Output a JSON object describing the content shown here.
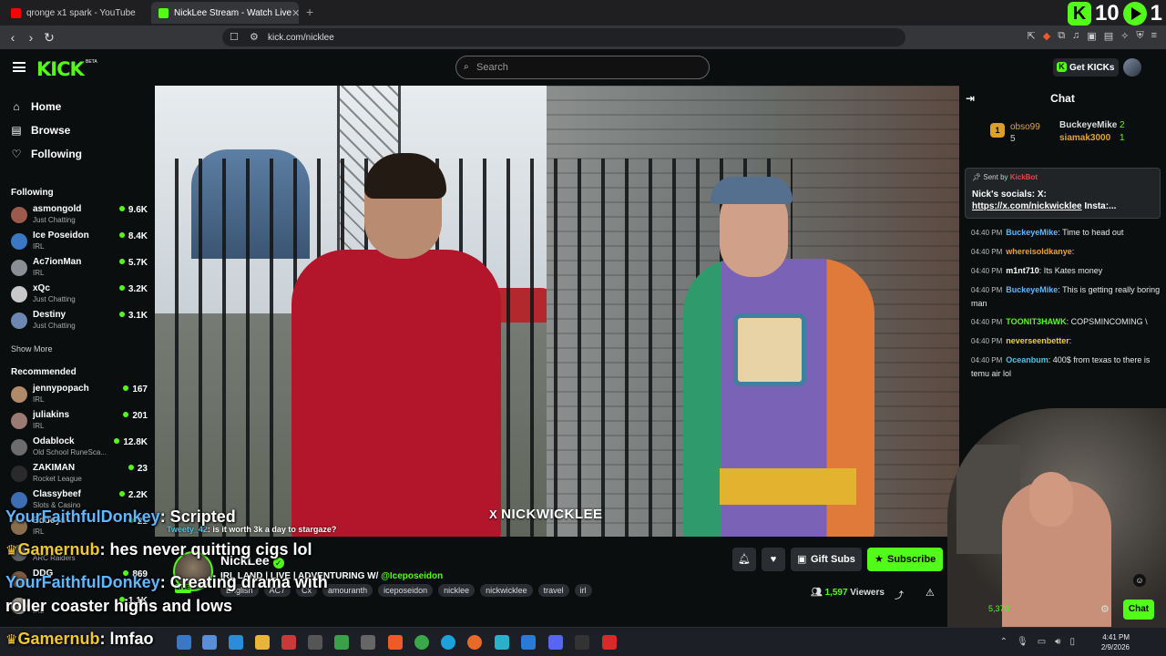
{
  "browser": {
    "tabs": [
      {
        "title": "qronge x1 spark - YouTube",
        "color": "#ff0000"
      },
      {
        "title": "NickLee Stream - Watch Live",
        "color": "#53fc18"
      }
    ],
    "new_tab": "+",
    "url": "kick.com/nicklee",
    "counter": {
      "left": "10",
      "right": "1"
    }
  },
  "header": {
    "logo": "KICK",
    "beta": "BETA",
    "search_placeholder": "Search",
    "get_kicks": "Get KICKs"
  },
  "sidebar": {
    "nav": [
      {
        "label": "Home",
        "icon": "home-icon"
      },
      {
        "label": "Browse",
        "icon": "browse-icon"
      },
      {
        "label": "Following",
        "icon": "heart-icon"
      }
    ],
    "following_title": "Following",
    "following": [
      {
        "name": "asmongold",
        "category": "Just Chatting",
        "viewers": "9.6K",
        "color": "#9c5a4a"
      },
      {
        "name": "Ice Poseidon",
        "category": "IRL",
        "viewers": "8.4K",
        "color": "#3a78c6"
      },
      {
        "name": "Ac7ionMan",
        "category": "IRL",
        "viewers": "5.7K",
        "color": "#8a8f95"
      },
      {
        "name": "xQc",
        "category": "Just Chatting",
        "viewers": "3.2K",
        "color": "#c9c9c9"
      },
      {
        "name": "Destiny",
        "category": "Just Chatting",
        "viewers": "3.1K",
        "color": "#6d88b0"
      }
    ],
    "show_more": "Show More",
    "recommended_title": "Recommended",
    "recommended": [
      {
        "name": "jennypopach",
        "category": "IRL",
        "viewers": "167",
        "color": "#b18a6a"
      },
      {
        "name": "juliakins",
        "category": "IRL",
        "viewers": "201",
        "color": "#9b7a74"
      },
      {
        "name": "Odablock",
        "category": "Old School RuneSca...",
        "viewers": "12.8K",
        "color": "#6c6c6c"
      },
      {
        "name": "ZAKIMAN",
        "category": "Rocket League",
        "viewers": "23",
        "color": "#2a2a2a"
      },
      {
        "name": "Classybeef",
        "category": "Slots & Casino",
        "viewers": "2.2K",
        "color": "#3d6db3"
      },
      {
        "name": "Edboys",
        "category": "IRL",
        "viewers": "21",
        "color": "#8a6d4d"
      },
      {
        "name": "",
        "category": "ARC Raiders",
        "viewers": "",
        "color": "#5a5e62"
      },
      {
        "name": "DDG",
        "category": "",
        "viewers": "869",
        "color": "#7a5a44"
      },
      {
        "name": "",
        "category": "IRL",
        "viewers": "1.1K",
        "color": "#a09a90"
      }
    ]
  },
  "video": {
    "watermark": "NICKWICKLEE",
    "watermark_prefix": "X"
  },
  "stream": {
    "name": "NickLee",
    "live_badge": "LIVE",
    "title_prefix": "IRL LAND | LIVE | ADVENTURING W/ ",
    "title_mention": "@Iceposeidon",
    "tags": [
      "English",
      "AC7",
      "Cx",
      "amouranth",
      "iceposeidon",
      "nicklee",
      "nickwicklee",
      "travel",
      "irl"
    ],
    "gift_subs": "Gift Subs",
    "subscribe": "Subscribe",
    "viewers_count": "1,597",
    "viewers_label": "Viewers"
  },
  "chat": {
    "title": "Chat",
    "leaderboard": {
      "first_rank": "1",
      "first_name": "obso99",
      "first_count": "5",
      "second_name": "BuckeyeMike",
      "second_count": "2",
      "third_name": "siamak3000",
      "third_count": "1"
    },
    "pinned": {
      "sent_by": "Sent by",
      "bot": "KickBot",
      "message": "Nick's socials: X: ",
      "url": "https://x.com/nickwicklee",
      "suffix": " Insta:..."
    },
    "messages": [
      {
        "time": "04:40 PM",
        "user": "BuckeyeMike",
        "color": "#5fb8ff",
        "text": ": Time to head out"
      },
      {
        "time": "04:40 PM",
        "user": "whereisoldkanye",
        "color": "#e8a23a",
        "text": ":"
      },
      {
        "time": "04:40 PM",
        "user": "m1nt710",
        "color": "#ffffff",
        "text": ": Its Kates money"
      },
      {
        "time": "04:40 PM",
        "user": "BuckeyeMike",
        "color": "#5fb8ff",
        "text": ": This is getting really boring man"
      },
      {
        "time": "04:40 PM",
        "user": "TOONIT3HAWK",
        "color": "#53fc18",
        "text": ": COPSMINCOMING \\"
      },
      {
        "time": "04:40 PM",
        "user": "neverseenbetter",
        "color": "#e8d33a",
        "text": ":"
      },
      {
        "time": "04:40 PM",
        "user": "Oceanbum",
        "color": "#53c2e0",
        "text": ": 400$ from texas to there is temu air lol"
      }
    ],
    "kicks_count": "5,370",
    "chat_button": "Chat"
  },
  "overlay": {
    "small": {
      "user": "Tweety_42",
      "text": ": is it worth 3k a day to stargaze?"
    },
    "lines": [
      {
        "user": "YourFaithfulDonkey",
        "text": ": Scripted",
        "crown": ""
      },
      {
        "user": "Gamernub",
        "text": ": hes never quitting cigs lol",
        "crown": "♛"
      },
      {
        "user": "YourFaithfulDonkey",
        "text": ": Creating drama with",
        "crown": ""
      },
      {
        "user": "",
        "text": "roller coaster highs and lows",
        "crown": ""
      },
      {
        "user": "Gamernub",
        "text": ": lmfao",
        "crown": "♛"
      }
    ]
  },
  "taskbar": {
    "time": "4:41 PM",
    "date": "2/9/2026"
  }
}
